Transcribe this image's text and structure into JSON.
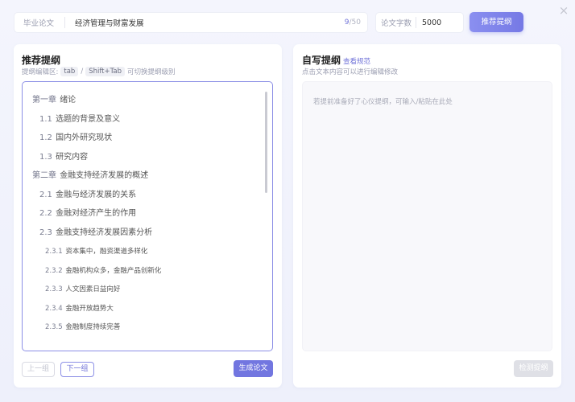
{
  "window": {
    "close_icon": "×"
  },
  "topbar": {
    "topic_label": "毕业论文",
    "topic_value": "经济管理与财富发展",
    "count_current": "9",
    "count_max": "/50",
    "words_label": "论文字数",
    "words_value": "5000",
    "recommend_label": "推荐提纲"
  },
  "left_panel": {
    "title": "推荐提纲",
    "hint_prefix": "提纲编辑区:",
    "hint_key1": "tab",
    "hint_sep": "/",
    "hint_key2": "Shift+Tab",
    "hint_suffix": "可切换提纲级别",
    "outline": [
      {
        "level": 1,
        "num": "第一章",
        "text": "绪论"
      },
      {
        "level": 2,
        "num": "1.1",
        "text": "选题的背景及意义"
      },
      {
        "level": 2,
        "num": "1.2",
        "text": "国内外研究现状"
      },
      {
        "level": 2,
        "num": "1.3",
        "text": "研究内容"
      },
      {
        "level": 1,
        "num": "第二章",
        "text": "金融支持经济发展的概述"
      },
      {
        "level": 2,
        "num": "2.1",
        "text": "金融与经济发展的关系"
      },
      {
        "level": 2,
        "num": "2.2",
        "text": "金融对经济产生的作用"
      },
      {
        "level": 2,
        "num": "2.3",
        "text": "金融支持经济发展因素分析"
      },
      {
        "level": 3,
        "num": "2.3.1",
        "text": "资本集中，融资渠道多样化"
      },
      {
        "level": 3,
        "num": "2.3.2",
        "text": "金融机构众多，金融产品创新化"
      },
      {
        "level": 3,
        "num": "2.3.3",
        "text": "人文因素日益向好"
      },
      {
        "level": 3,
        "num": "2.3.4",
        "text": "金融开放趋势大"
      },
      {
        "level": 3,
        "num": "2.3.5",
        "text": "金融制度持续完善"
      }
    ],
    "prev_label": "上一组",
    "next_label": "下一组",
    "generate_label": "生成论文"
  },
  "right_panel": {
    "title": "自写提纲",
    "link": "查看规范",
    "hint": "点击文本内容可以进行编辑修改",
    "placeholder": "若提前准备好了心仪提纲，可输入/粘贴在此处",
    "check_label": "检测提纲"
  },
  "colors": {
    "accent": "#7276e0",
    "accent_light": "#8c8fe6",
    "disabled": "#dfe0e6"
  }
}
